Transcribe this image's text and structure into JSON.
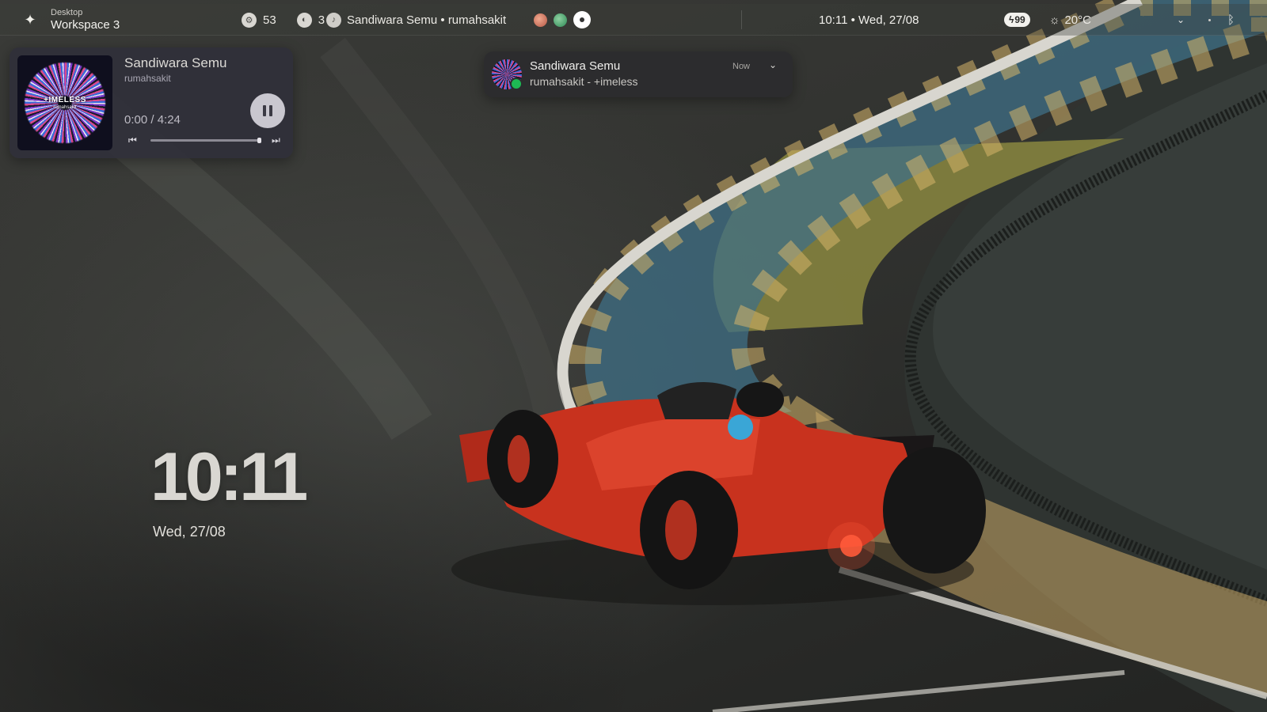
{
  "topbar": {
    "workspace": {
      "subtitle": "Desktop",
      "title": "Workspace 3",
      "icon": "sparkle-icon"
    },
    "stats": [
      {
        "icon": "cpu-icon",
        "value": "53"
      },
      {
        "icon": "memory-icon",
        "value": "3"
      }
    ],
    "media": {
      "icon": "music-icon",
      "text": "Sandiwara Semu • rumahsakit"
    },
    "apps": [
      "app-icon-1",
      "app-icon-2",
      "app-icon-3"
    ],
    "clock": "10:11 • Wed, 27/08",
    "battery": "99",
    "weather": "20°C"
  },
  "player": {
    "cover_title": "+IMELESS",
    "cover_artist": "rumahsakit",
    "title": "Sandiwara Semu",
    "artist": "rumahsakit",
    "time": "0:00 / 4:24",
    "progress": 0.98
  },
  "notification": {
    "title": "Sandiwara Semu",
    "body": "rumahsakit - +imeless",
    "time": "Now",
    "app": "spotify-icon"
  },
  "desktop_clock": {
    "time": "10:11",
    "date": "Wed, 27/08"
  },
  "colors": {
    "accent": "#1db954",
    "car_red": "#c8321e",
    "curb_yellow": "#d6b46a",
    "curb_blue": "#3f6f86"
  }
}
